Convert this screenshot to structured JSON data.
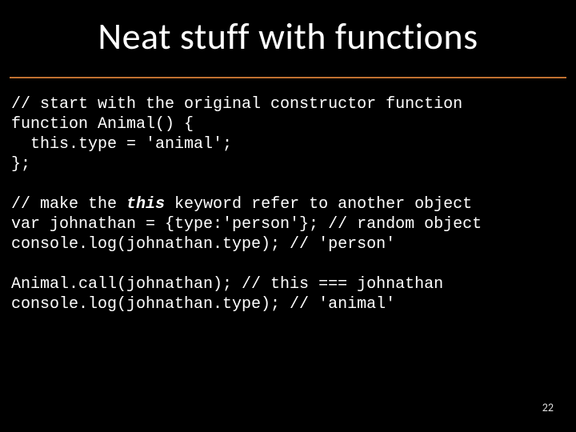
{
  "slide": {
    "title": "Neat stuff with functions",
    "page_number": "22"
  },
  "code": {
    "l01": "// start with the original constructor function",
    "l02": "function Animal() {",
    "l03": "  this.type = 'animal';",
    "l04": "};",
    "l05": "",
    "l06a": "// make the ",
    "l06b": "this",
    "l06c": " keyword refer to another object",
    "l07": "var johnathan = {type:'person'}; // random object",
    "l08": "console.log(johnathan.type); // 'person'",
    "l09": "",
    "l10": "Animal.call(johnathan); // this === johnathan",
    "l11": "console.log(johnathan.type); // 'animal'"
  }
}
